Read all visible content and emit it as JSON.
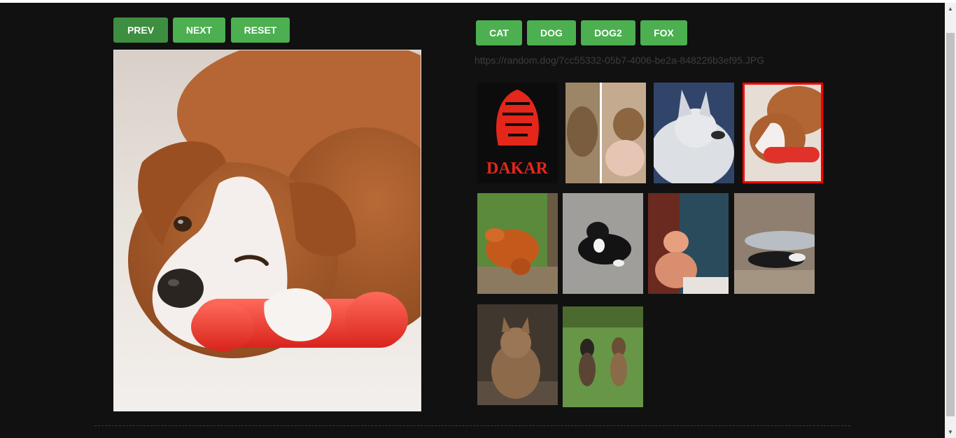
{
  "left_toolbar": {
    "prev_label": "PREV",
    "next_label": "NEXT",
    "reset_label": "RESET"
  },
  "right_toolbar": {
    "cat_label": "CAT",
    "dog_label": "DOG",
    "dog2_label": "DOG2",
    "fox_label": "FOX"
  },
  "current_url": "https://random.dog/7cc55332-05b7-4006-be2a-848226b3ef95.JPG",
  "main_image": {
    "subject": "puppy with red chew toy"
  },
  "thumbnails": [
    {
      "subject": "dakar logo",
      "logo_text": "DAKAR",
      "selected": false
    },
    {
      "subject": "cats collage",
      "selected": false
    },
    {
      "subject": "fluffy spitz dog",
      "selected": false
    },
    {
      "subject": "puppy with red toy",
      "selected": true
    },
    {
      "subject": "red fox",
      "selected": false
    },
    {
      "subject": "tuxedo cat",
      "selected": false
    },
    {
      "subject": "chihuahua in car",
      "selected": false
    },
    {
      "subject": "cat under bed",
      "selected": false
    },
    {
      "subject": "brown dog",
      "selected": false
    },
    {
      "subject": "two german shepherds",
      "selected": false
    }
  ],
  "colors": {
    "button_green": "#4caf50",
    "button_green_active": "#3e8e41",
    "background": "#111111",
    "selection_border": "#ff0000"
  }
}
